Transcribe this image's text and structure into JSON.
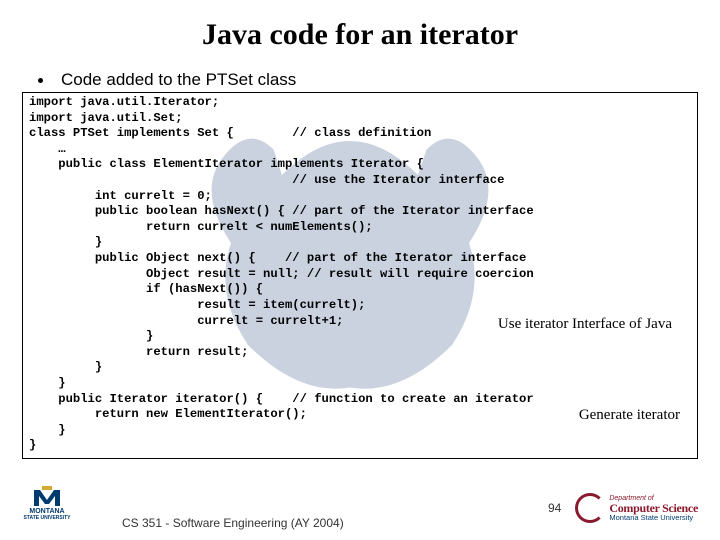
{
  "title": "Java code for an iterator",
  "bullet": "Code added to the PTSet class",
  "code": "import java.util.Iterator;\nimport java.util.Set;\nclass PTSet implements Set {        // class definition\n    …\n    public class ElementIterator implements Iterator {\n                                    // use the Iterator interface\n         int currelt = 0;\n         public boolean hasNext() { // part of the Iterator interface\n                return currelt < numElements();\n         }\n         public Object next() {    // part of the Iterator interface\n                Object result = null; // result will require coercion\n                if (hasNext()) {\n                       result = item(currelt);\n                       currelt = currelt+1;\n                }\n                return result;\n         }\n    }\n    public Iterator iterator() {    // function to create an iterator\n         return new ElementIterator();\n    }\n}",
  "annotation1": "Use iterator\nInterface of Java",
  "annotation2": "Generate iterator",
  "footer": "CS 351 - Software Engineering (AY 2004)",
  "page": "94",
  "msu_label1": "MONTANA",
  "msu_label2": "STATE UNIVERSITY",
  "cs_dept": "Department of",
  "cs_name": "Computer Science",
  "cs_univ": "Montana State University"
}
